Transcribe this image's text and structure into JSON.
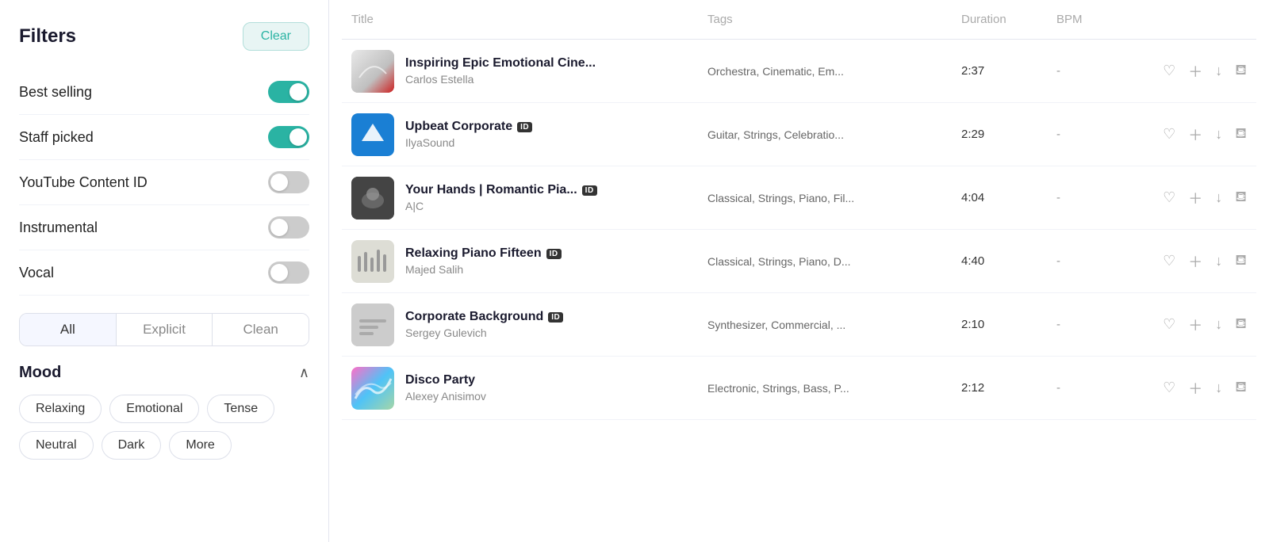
{
  "sidebar": {
    "filters_title": "Filters",
    "clear_label": "Clear",
    "filters": [
      {
        "id": "best-selling",
        "label": "Best selling",
        "enabled": true
      },
      {
        "id": "staff-picked",
        "label": "Staff picked",
        "enabled": true
      },
      {
        "id": "youtube-content-id",
        "label": "YouTube Content ID",
        "enabled": false
      },
      {
        "id": "instrumental",
        "label": "Instrumental",
        "enabled": false
      },
      {
        "id": "vocal",
        "label": "Vocal",
        "enabled": false
      }
    ],
    "content_type": {
      "options": [
        "All",
        "Explicit",
        "Clean"
      ],
      "active": "All"
    },
    "mood": {
      "title": "Mood",
      "tags": [
        "Relaxing",
        "Emotional",
        "Tense",
        "Neutral",
        "Dark",
        "More"
      ]
    }
  },
  "table": {
    "headers": {
      "title": "Title",
      "tags": "Tags",
      "duration": "Duration",
      "bpm": "BPM",
      "actions": ""
    },
    "tracks": [
      {
        "id": "inspiring",
        "title": "Inspiring Epic Emotional Cine...",
        "artist": "Carlos Estella",
        "tags": "Orchestra, Cinematic, Em...",
        "duration": "2:37",
        "bpm": "-",
        "has_id_badge": false,
        "thumb_type": "inspiring"
      },
      {
        "id": "upbeat",
        "title": "Upbeat Corporate",
        "artist": "IlyaSound",
        "tags": "Guitar, Strings, Celebratio...",
        "duration": "2:29",
        "bpm": "-",
        "has_id_badge": true,
        "thumb_type": "upbeat"
      },
      {
        "id": "romantic",
        "title": "Your Hands | Romantic Pia...",
        "artist": "A|C",
        "tags": "Classical, Strings, Piano, Fil...",
        "duration": "4:04",
        "bpm": "-",
        "has_id_badge": true,
        "thumb_type": "romantic"
      },
      {
        "id": "relaxing",
        "title": "Relaxing Piano Fifteen",
        "artist": "Majed Salih",
        "tags": "Classical, Strings, Piano, D...",
        "duration": "4:40",
        "bpm": "-",
        "has_id_badge": true,
        "thumb_type": "relaxing"
      },
      {
        "id": "corporate",
        "title": "Corporate Background",
        "artist": "Sergey Gulevich",
        "tags": "Synthesizer, Commercial, ...",
        "duration": "2:10",
        "bpm": "-",
        "has_id_badge": true,
        "thumb_type": "corporate"
      },
      {
        "id": "disco",
        "title": "Disco Party",
        "artist": "Alexey Anisimov",
        "tags": "Electronic, Strings, Bass, P...",
        "duration": "2:12",
        "bpm": "-",
        "has_id_badge": false,
        "thumb_type": "disco"
      }
    ]
  }
}
